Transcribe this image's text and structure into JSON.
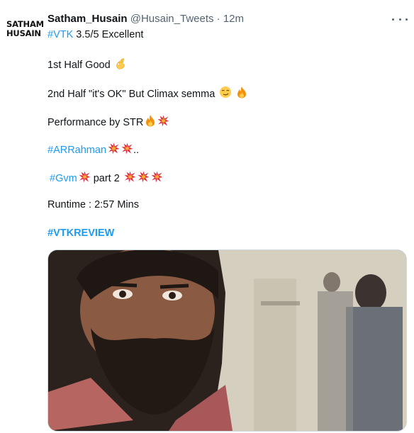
{
  "author": {
    "avatar_line1": "SATHAM",
    "avatar_line2": "HUSAIN",
    "display_name": "Satham_Husain",
    "handle": "@Husain_Tweets",
    "separator": "·",
    "time": "12m"
  },
  "tweet": {
    "line1_tag": "#VTK",
    "line1_text": " 3.5/5 Excellent",
    "line2_text": "1st Half Good",
    "line3_text": "2nd Half \"it's OK\" But Climax semma",
    "line4_text": "Performance by STR",
    "line5_tag": "#ARRahman",
    "line5_suffix": "..",
    "line6_tag": "#Gvm",
    "line6_text": " part 2 ",
    "line7_text": "Runtime : 2:57 Mins",
    "line8_tag": "#VTKREVIEW"
  },
  "icons": [
    "more-icon",
    "ok-hand-emoji",
    "smirk-emoji",
    "fire-emoji",
    "collision-emoji"
  ],
  "colors": {
    "link": "#1d9bf0",
    "text": "#0f1419",
    "muted": "#536471"
  }
}
